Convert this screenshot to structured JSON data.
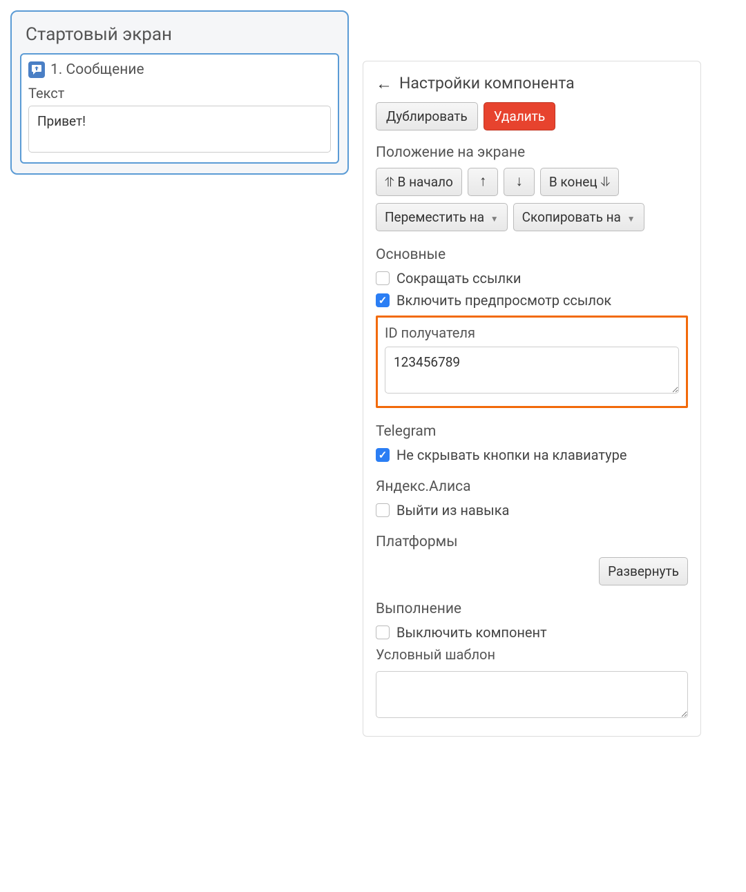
{
  "left": {
    "screen_title": "Стартовый экран",
    "card_title": "1. Сообщение",
    "text_label": "Текст",
    "text_value": "Привет!"
  },
  "right": {
    "header": "Настройки компонента",
    "buttons": {
      "duplicate": "Дублировать",
      "delete": "Удалить"
    },
    "position": {
      "label": "Положение на экране",
      "to_start": "⥣ В начало",
      "up": "↑",
      "down": "↓",
      "to_end": "В конец ⥥",
      "move_to": "Переместить на",
      "copy_to": "Скопировать на"
    },
    "main": {
      "label": "Основные",
      "shorten_links": "Сокращать ссылки",
      "enable_preview": "Включить предпросмотр ссылок",
      "recipient_id_label": "ID получателя",
      "recipient_id_value": "123456789"
    },
    "telegram": {
      "label": "Telegram",
      "keep_buttons": "Не скрывать кнопки на клавиатуре"
    },
    "alice": {
      "label": "Яндекс.Алиса",
      "exit_skill": "Выйти из навыка"
    },
    "platforms": {
      "label": "Платформы",
      "expand": "Развернуть"
    },
    "execution": {
      "label": "Выполнение",
      "disable_component": "Выключить компонент",
      "template_label": "Условный шаблон",
      "template_value": ""
    }
  }
}
